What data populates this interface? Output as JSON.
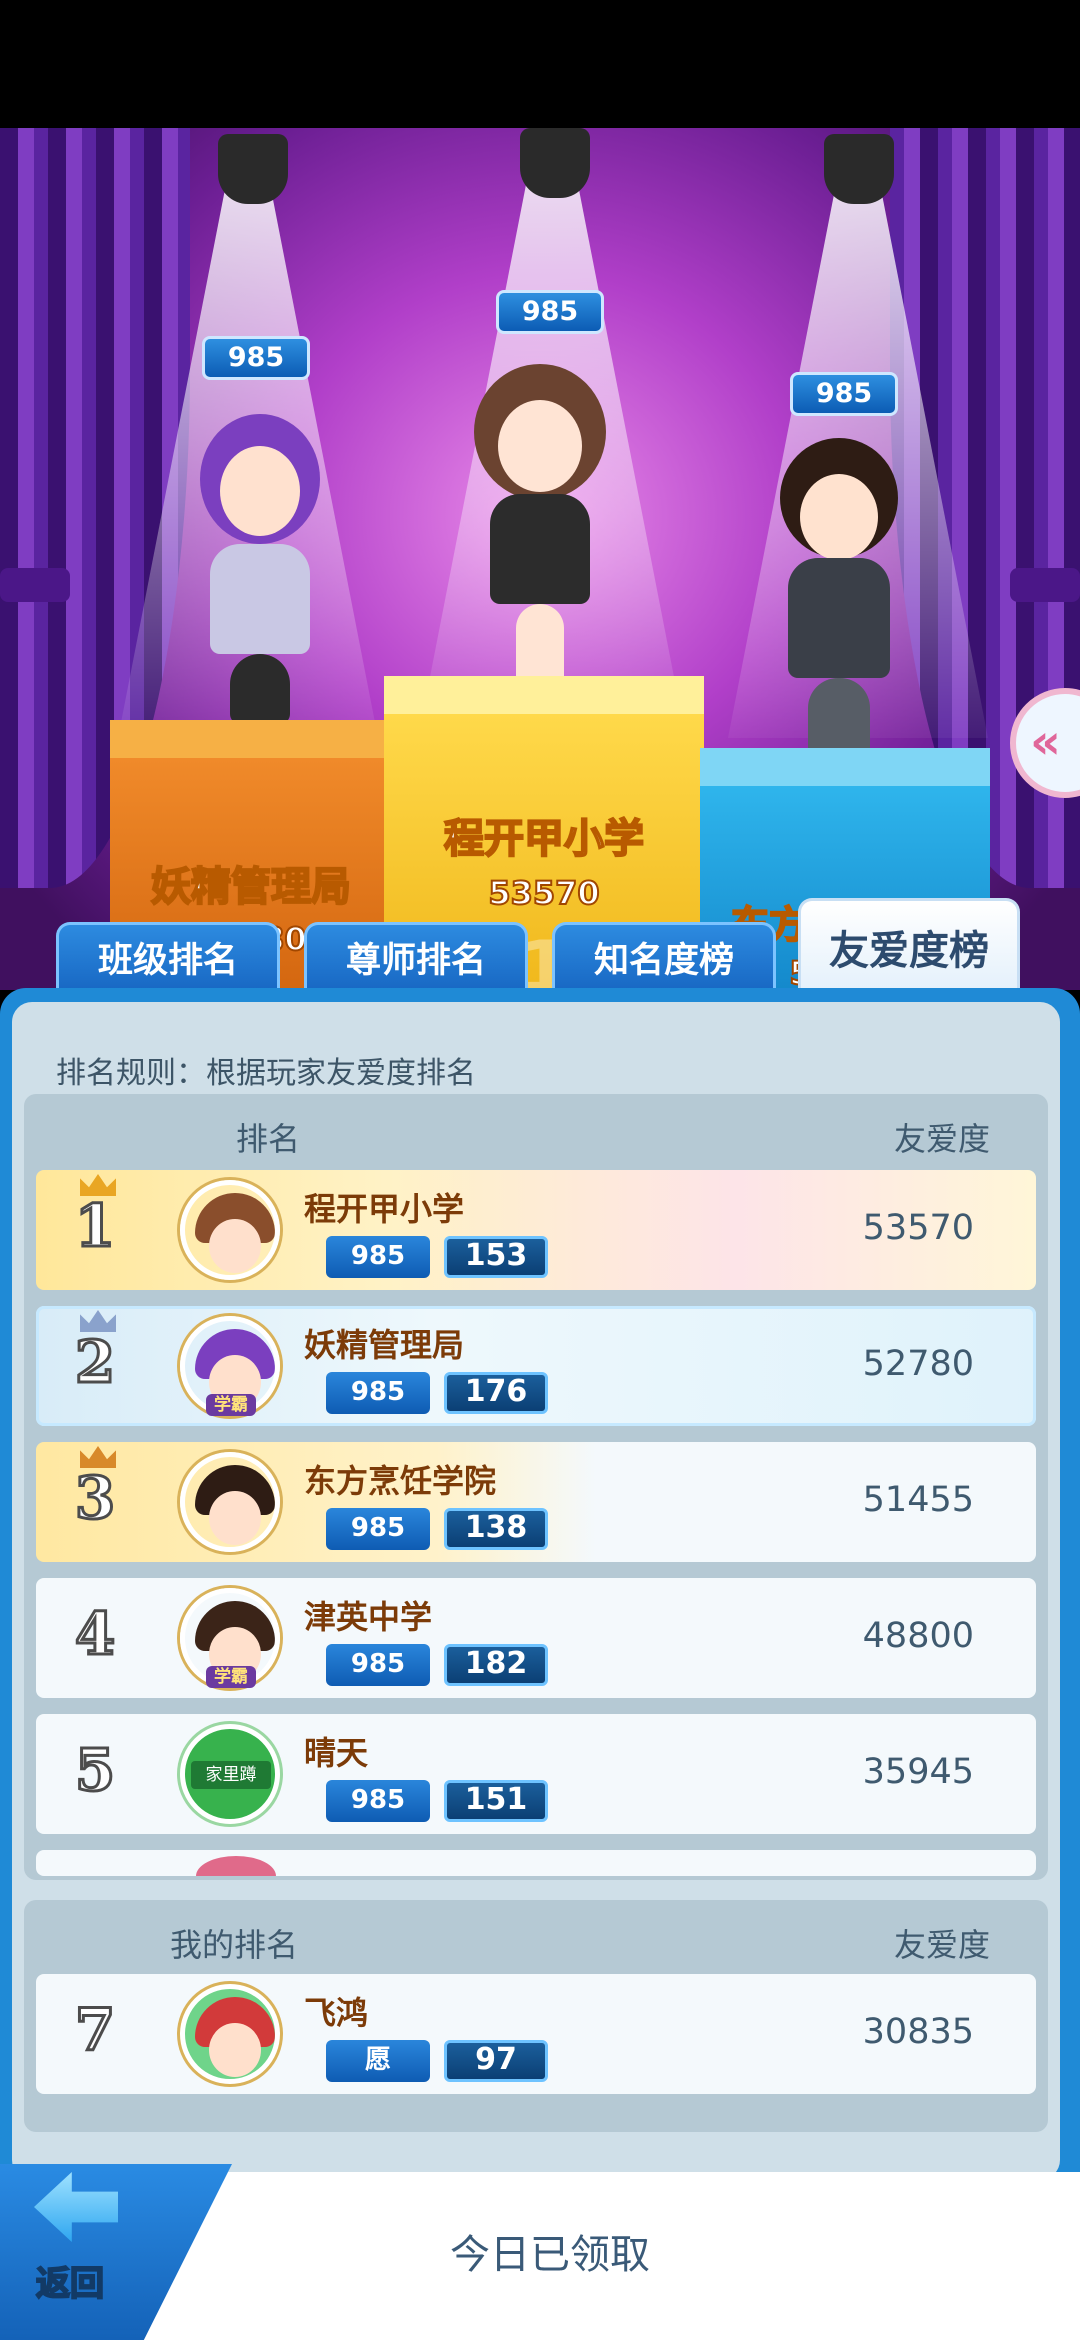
{
  "stage": {
    "podium": [
      {
        "place": "2",
        "name": "妖精管理局",
        "score": "52780",
        "tag": "985"
      },
      {
        "place": "1",
        "name": "程开甲小学",
        "score": "53570",
        "tag": "985"
      },
      {
        "place": "3",
        "name": "东方烹饪学院",
        "score": "51455",
        "tag": "985"
      }
    ],
    "side_arrow": "«"
  },
  "tabs": [
    {
      "label": "班级排名",
      "active": false
    },
    {
      "label": "尊师排名",
      "active": false
    },
    {
      "label": "知名度榜",
      "active": false
    },
    {
      "label": "友爱度榜",
      "active": true
    }
  ],
  "panel": {
    "rule": "排名规则：根据玩家友爱度排名",
    "header_rank": "排名",
    "header_score": "友爱度",
    "rows": [
      {
        "rank": "1",
        "name": "程开甲小学",
        "level": "985",
        "count": "153",
        "score": "53570"
      },
      {
        "rank": "2",
        "name": "妖精管理局",
        "level": "985",
        "count": "176",
        "score": "52780",
        "badge": "学霸"
      },
      {
        "rank": "3",
        "name": "东方烹饪学院",
        "level": "985",
        "count": "138",
        "score": "51455"
      },
      {
        "rank": "4",
        "name": "津英中学",
        "level": "985",
        "count": "182",
        "score": "48800",
        "badge": "学霸"
      },
      {
        "rank": "5",
        "name": "晴天",
        "level": "985",
        "count": "151",
        "score": "35945",
        "badge": "家里蹲"
      }
    ],
    "my_header_rank": "我的排名",
    "my_header_score": "友爱度",
    "my_row": {
      "rank": "7",
      "name": "飞鸿",
      "level": "愿",
      "count": "97",
      "score": "30835"
    }
  },
  "bottom": {
    "claim": "今日已领取",
    "back": "返回"
  },
  "colors": {
    "panel_blue": "#1f8ad6",
    "tab_blue": "#1766c2",
    "gold_row": "#ffe79a"
  }
}
